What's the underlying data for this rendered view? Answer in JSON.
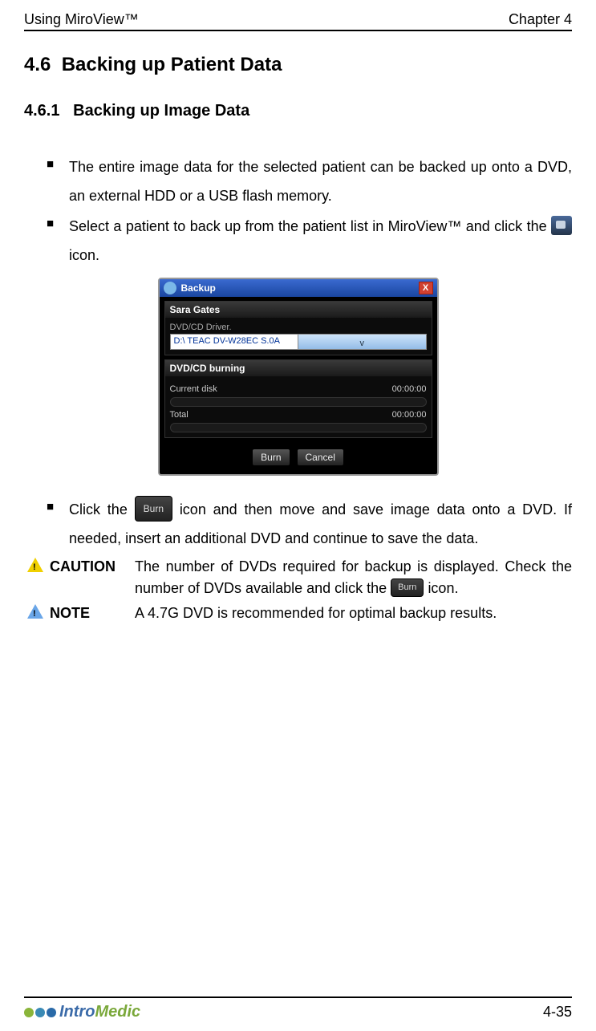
{
  "header": {
    "left": "Using MiroView™",
    "right": "Chapter 4"
  },
  "section": {
    "num": "4.6",
    "title": "Backing up Patient Data"
  },
  "subsection": {
    "num": "4.6.1",
    "title": "Backing up Image Data"
  },
  "bullets": {
    "b1": "The entire image data for the selected patient can be backed up onto a DVD, an external HDD or a USB flash memory.",
    "b2a": "Select a patient to back up from the patient list in MiroView™ and click the ",
    "b2b": " icon.",
    "b3a": "Click the ",
    "b3b": " icon and then move and save image data onto a DVD. If needed, insert an additional DVD and continue to save the data."
  },
  "dialog": {
    "title": "Backup",
    "close": "X",
    "patient": "Sara Gates",
    "driverLabel": "DVD/CD Driver.",
    "driverValue": "D:\\ TEAC   DV-W28EC      S.0A",
    "burnSection": "DVD/CD burning",
    "currentLabel": "Current disk",
    "currentTime": "00:00:00",
    "totalLabel": "Total",
    "totalTime": "00:00:00",
    "burn": "Burn",
    "cancel": "Cancel"
  },
  "burnInline": "Burn",
  "caution": {
    "label": "CAUTION",
    "text_a": "The number of DVDs required for backup is displayed. Check the number of DVDs available and click the ",
    "text_b": " icon."
  },
  "note": {
    "label": "NOTE",
    "text": "A 4.7G DVD is recommended for optimal backup results."
  },
  "footer": {
    "brand_a": "Intro",
    "brand_b": "Medic",
    "page": "4-35"
  }
}
